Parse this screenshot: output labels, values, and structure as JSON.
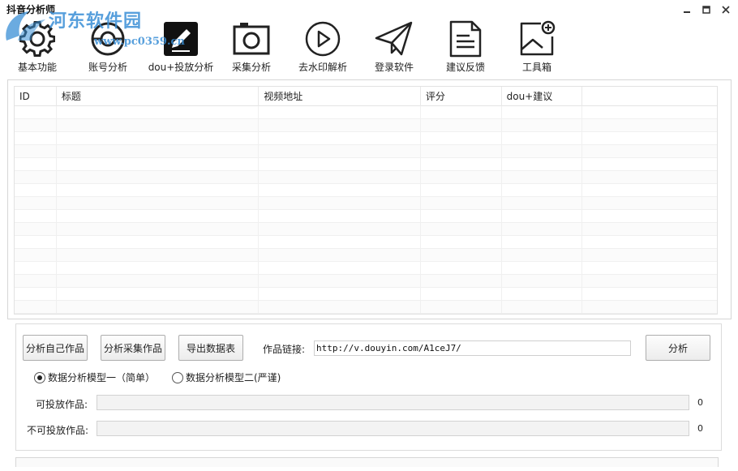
{
  "window": {
    "title": "抖音分析师",
    "watermark_title": "河东软件园",
    "watermark_url": "www.pc0359.cn"
  },
  "toolbar": {
    "items": [
      {
        "label": "基本功能",
        "icon": "gear-icon"
      },
      {
        "label": "账号分析",
        "icon": "target-icon"
      },
      {
        "label": "dou+投放分析",
        "icon": "edit-pen-icon"
      },
      {
        "label": "采集分析",
        "icon": "camera-icon"
      },
      {
        "label": "去水印解析",
        "icon": "play-circle-icon"
      },
      {
        "label": "登录软件",
        "icon": "paper-plane-icon"
      },
      {
        "label": "建议反馈",
        "icon": "document-icon"
      },
      {
        "label": "工具箱",
        "icon": "image-add-icon"
      }
    ]
  },
  "table": {
    "columns": [
      "ID",
      "标题",
      "视频地址",
      "评分",
      "dou+建议",
      ""
    ],
    "rows": []
  },
  "controls": {
    "btn_analyze_own": "分析自己作品",
    "btn_analyze_collected": "分析采集作品",
    "btn_export": "导出数据表",
    "url_label": "作品链接:",
    "url_value": "http://v.douyin.com/A1ceJ7/",
    "btn_analyze": "分析",
    "radio_model1": "数据分析模型一（简单）",
    "radio_model2": "数据分析模型二(严谨)",
    "radio_selected": "model1",
    "deliverable_label": "可投放作品:",
    "deliverable_count": "0",
    "deliverable_progress": 0,
    "non_deliverable_label": "不可投放作品:",
    "non_deliverable_count": "0",
    "non_deliverable_progress": 0
  },
  "colors": {
    "watermark": "#3a8fd6",
    "border": "#d6d6d6"
  }
}
